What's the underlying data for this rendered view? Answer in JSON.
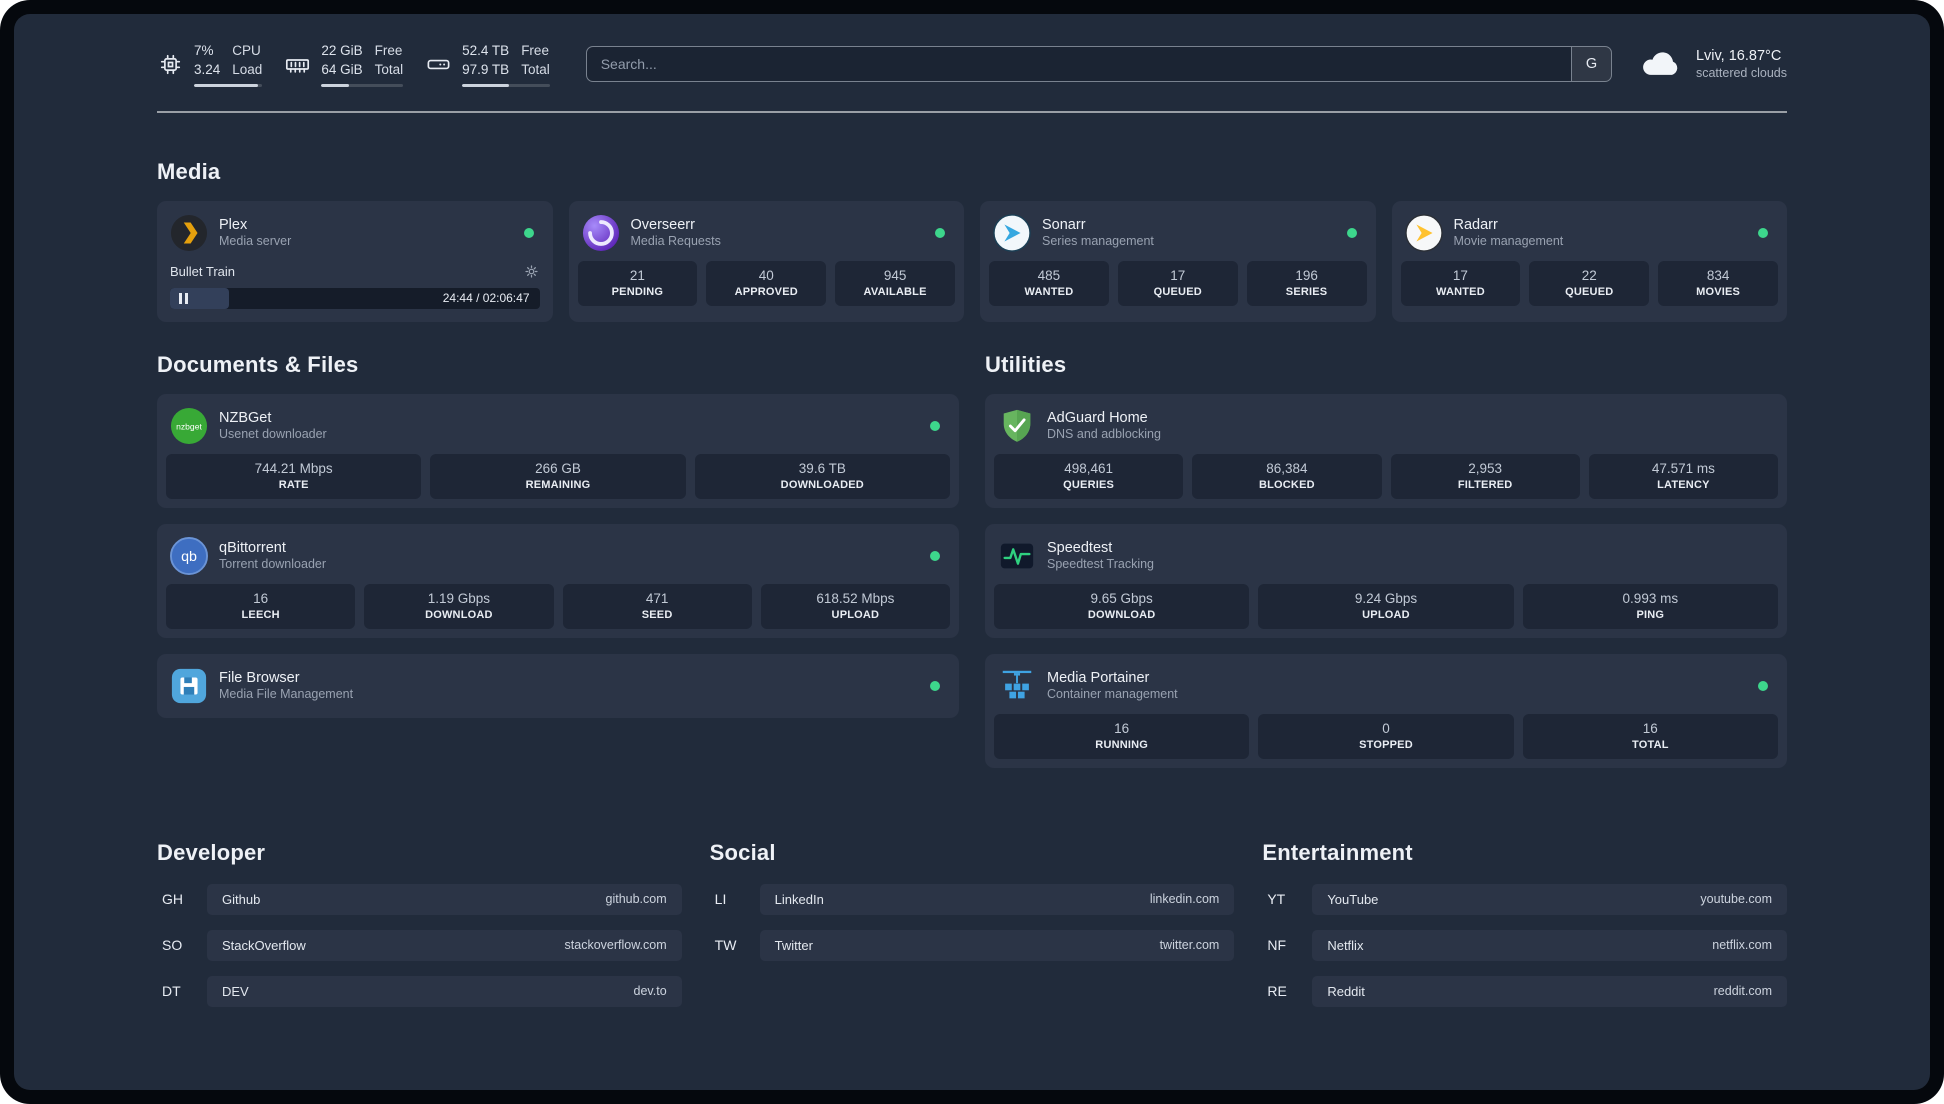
{
  "colors": {
    "status_online": "#3dd68c",
    "accent_green": "#2fd180"
  },
  "topbar": {
    "resources": [
      {
        "icon": "cpu-icon",
        "values": [
          "7%",
          "3.24"
        ],
        "labels": [
          "CPU",
          "Load"
        ],
        "progress": 93
      },
      {
        "icon": "memory-icon",
        "values": [
          "22 GiB",
          "64 GiB"
        ],
        "labels": [
          "Free",
          "Total"
        ],
        "progress": 34
      },
      {
        "icon": "disk-icon",
        "values": [
          "52.4 TB",
          "97.9 TB"
        ],
        "labels": [
          "Free",
          "Total"
        ],
        "progress": 54
      }
    ],
    "search": {
      "placeholder": "Search...",
      "provider_label": "G"
    },
    "weather": {
      "location": "Lviv, 16.87°C",
      "condition": "scattered clouds"
    }
  },
  "sections": {
    "media": {
      "title": "Media",
      "services": [
        {
          "name": "Plex",
          "subtitle": "Media server",
          "status": "online",
          "now_playing": {
            "title": "Bullet Train",
            "time": "24:44 / 02:06:47",
            "progress_percent": 16
          }
        },
        {
          "name": "Overseerr",
          "subtitle": "Media Requests",
          "status": "online",
          "stats": [
            {
              "value": "21",
              "label": "PENDING"
            },
            {
              "value": "40",
              "label": "APPROVED"
            },
            {
              "value": "945",
              "label": "AVAILABLE"
            }
          ]
        },
        {
          "name": "Sonarr",
          "subtitle": "Series management",
          "status": "online",
          "stats": [
            {
              "value": "485",
              "label": "WANTED"
            },
            {
              "value": "17",
              "label": "QUEUED"
            },
            {
              "value": "196",
              "label": "SERIES"
            }
          ]
        },
        {
          "name": "Radarr",
          "subtitle": "Movie management",
          "status": "online",
          "stats": [
            {
              "value": "17",
              "label": "WANTED"
            },
            {
              "value": "22",
              "label": "QUEUED"
            },
            {
              "value": "834",
              "label": "MOVIES"
            }
          ]
        }
      ]
    },
    "documents": {
      "title": "Documents & Files",
      "services": [
        {
          "name": "NZBGet",
          "subtitle": "Usenet downloader",
          "status": "online",
          "stats": [
            {
              "value": "744.21 Mbps",
              "label": "RATE"
            },
            {
              "value": "266 GB",
              "label": "REMAINING"
            },
            {
              "value": "39.6 TB",
              "label": "DOWNLOADED"
            }
          ]
        },
        {
          "name": "qBittorrent",
          "subtitle": "Torrent downloader",
          "status": "online",
          "stats": [
            {
              "value": "16",
              "label": "LEECH"
            },
            {
              "value": "1.19 Gbps",
              "label": "DOWNLOAD"
            },
            {
              "value": "471",
              "label": "SEED"
            },
            {
              "value": "618.52 Mbps",
              "label": "UPLOAD"
            }
          ]
        },
        {
          "name": "File Browser",
          "subtitle": "Media File Management",
          "status": "online",
          "stats": []
        }
      ]
    },
    "utilities": {
      "title": "Utilities",
      "services": [
        {
          "name": "AdGuard Home",
          "subtitle": "DNS and adblocking",
          "stats": [
            {
              "value": "498,461",
              "label": "QUERIES"
            },
            {
              "value": "86,384",
              "label": "BLOCKED"
            },
            {
              "value": "2,953",
              "label": "FILTERED"
            },
            {
              "value": "47.571 ms",
              "label": "LATENCY"
            }
          ]
        },
        {
          "name": "Speedtest",
          "subtitle": "Speedtest Tracking",
          "stats": [
            {
              "value": "9.65 Gbps",
              "label": "DOWNLOAD"
            },
            {
              "value": "9.24 Gbps",
              "label": "UPLOAD"
            },
            {
              "value": "0.993 ms",
              "label": "PING"
            }
          ]
        },
        {
          "name": "Media Portainer",
          "subtitle": "Container management",
          "status": "online",
          "stats": [
            {
              "value": "16",
              "label": "RUNNING"
            },
            {
              "value": "0",
              "label": "STOPPED"
            },
            {
              "value": "16",
              "label": "TOTAL"
            }
          ]
        }
      ]
    },
    "bookmarks": [
      {
        "title": "Developer",
        "items": [
          {
            "abbr": "GH",
            "name": "Github",
            "url": "github.com"
          },
          {
            "abbr": "SO",
            "name": "StackOverflow",
            "url": "stackoverflow.com"
          },
          {
            "abbr": "DT",
            "name": "DEV",
            "url": "dev.to"
          }
        ]
      },
      {
        "title": "Social",
        "items": [
          {
            "abbr": "LI",
            "name": "LinkedIn",
            "url": "linkedin.com"
          },
          {
            "abbr": "TW",
            "name": "Twitter",
            "url": "twitter.com"
          }
        ]
      },
      {
        "title": "Entertainment",
        "items": [
          {
            "abbr": "YT",
            "name": "YouTube",
            "url": "youtube.com"
          },
          {
            "abbr": "NF",
            "name": "Netflix",
            "url": "netflix.com"
          },
          {
            "abbr": "RE",
            "name": "Reddit",
            "url": "reddit.com"
          }
        ]
      }
    ]
  }
}
